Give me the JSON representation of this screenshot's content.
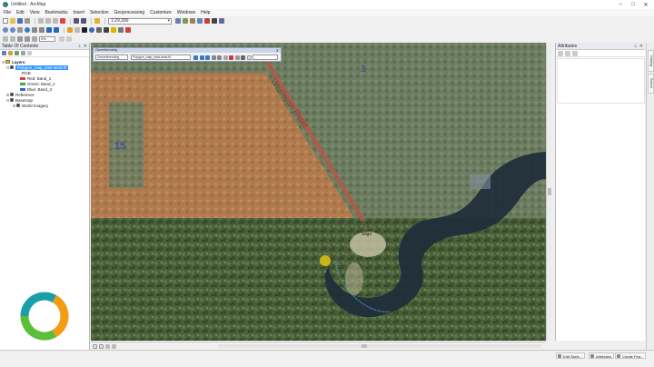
{
  "window": {
    "title": "Untitled - ArcMap"
  },
  "menu": [
    "File",
    "Edit",
    "View",
    "Bookmarks",
    "Insert",
    "Selection",
    "Geoprocessing",
    "Customize",
    "Windows",
    "Help"
  ],
  "toolbar": {
    "scale": "1:29,300",
    "zoom_percent": "0%"
  },
  "toc": {
    "title": "Table Of Contents",
    "layers_root": "Layers",
    "selected_layer": "Polygon_map_east-west.tif",
    "rgb_label": "RGB",
    "bands": [
      {
        "label": "Red:   Band_1",
        "color": "#e04040"
      },
      {
        "label": "Green: Band_2",
        "color": "#3cb043"
      },
      {
        "label": "Blue:  Band_3",
        "color": "#3a5fd0"
      }
    ],
    "reference": "Reference",
    "basemap": "Basemap",
    "world_imagery": "World Imagery"
  },
  "georef": {
    "title": "Georeferencing",
    "menu_label": "Georeferencing",
    "layer_value": "Polygon_map_east-west.tif"
  },
  "map": {
    "section_15": "15",
    "section_1": "1",
    "road_label": "Wesleyan Road",
    "place_label": "Sligo"
  },
  "attributes": {
    "title": "Attributes"
  },
  "side_tabs": [
    "Catalog",
    "Search"
  ],
  "bottom_tabs": [
    "Edit Sketc...",
    "Attributes",
    "Create Fea..."
  ],
  "colors": {
    "accent": "#3399ff",
    "logo_green": "#5bbf3a",
    "logo_orange": "#f39c12",
    "logo_teal": "#1a9fa8"
  }
}
